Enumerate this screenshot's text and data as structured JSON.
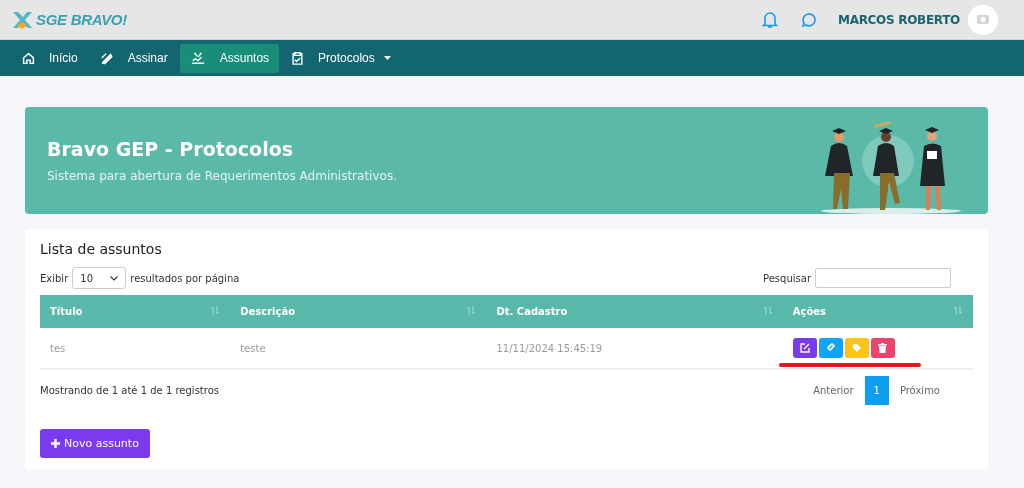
{
  "brand": {
    "name": "SGE BRAVO!"
  },
  "header": {
    "user_name": "MARCOS ROBERTO"
  },
  "nav": [
    {
      "label": "Início",
      "kind": "home",
      "selected": false,
      "dropdown": false
    },
    {
      "label": "Assinar",
      "kind": "pen",
      "selected": false,
      "dropdown": false
    },
    {
      "label": "Assuntos",
      "kind": "sign",
      "selected": true,
      "dropdown": false
    },
    {
      "label": "Protocolos",
      "kind": "clipboard",
      "selected": false,
      "dropdown": true
    }
  ],
  "banner": {
    "title": "Bravo GEP - Protocolos",
    "subtitle": "Sistema para abertura de Requerimentos Administrativos."
  },
  "list": {
    "title": "Lista de assuntos",
    "length_before": "Exibir",
    "page_size": "10",
    "length_after": "resultados por página",
    "search_label": "Pesquisar",
    "columns": [
      "Título",
      "Descrição",
      "Dt. Cadastro",
      "Ações"
    ],
    "rows": [
      {
        "cells": [
          "tes",
          "teste",
          "11/11/2024 15:45:19"
        ],
        "actions": [
          {
            "kind": "edit",
            "color": "#7c3aed"
          },
          {
            "kind": "attach",
            "color": "#0ea5f5"
          },
          {
            "kind": "tag",
            "color": "#fcc419"
          },
          {
            "kind": "delete",
            "color": "#f0426e"
          }
        ]
      }
    ],
    "info": "Mostrando de 1 até 1 de 1 registros",
    "pagination": {
      "previous": "Anterior",
      "pages": [
        {
          "label": "1",
          "selected": true
        }
      ],
      "next": "Próximo"
    },
    "add_button": "Novo assunto"
  }
}
